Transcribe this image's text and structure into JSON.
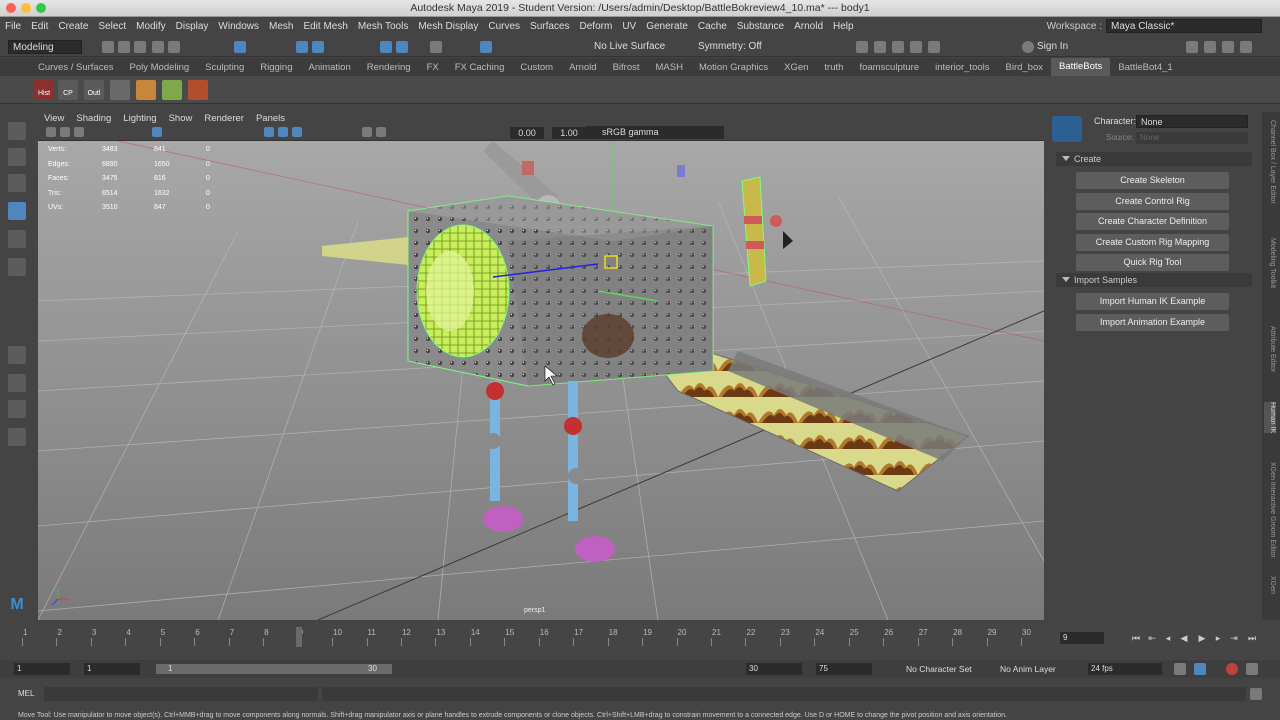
{
  "window": {
    "title": "Autodesk Maya 2019 - Student Version: /Users/admin/Desktop/BattleBokreview4_10.ma* --- body1"
  },
  "menu": [
    "File",
    "Edit",
    "Create",
    "Select",
    "Modify",
    "Display",
    "Windows",
    "Mesh",
    "Edit Mesh",
    "Mesh Tools",
    "Mesh Display",
    "Curves",
    "Surfaces",
    "Deform",
    "UV",
    "Generate",
    "Cache",
    "Substance",
    "Arnold",
    "Help"
  ],
  "workspace": {
    "label": "Workspace :",
    "value": "Maya Classic*"
  },
  "status_line": {
    "mode": "Modeling",
    "live_surface": "No Live Surface",
    "symmetry": "Symmetry: Off",
    "sign_in": "Sign In"
  },
  "shelf_tabs": [
    "Curves / Surfaces",
    "Poly Modeling",
    "Sculpting",
    "Rigging",
    "Animation",
    "Rendering",
    "FX",
    "FX Caching",
    "Custom",
    "Arnold",
    "Bifrost",
    "MASH",
    "Motion Graphics",
    "XGen",
    "truth",
    "foamsculpture",
    "interior_tools",
    "Bird_box",
    "BattleBots",
    "BattleBot4_1"
  ],
  "active_shelf": "BattleBots",
  "shelf_icons": [
    "Hist",
    "CP",
    "Outl"
  ],
  "viewport": {
    "menu": [
      "View",
      "Shading",
      "Lighting",
      "Show",
      "Renderer",
      "Panels"
    ],
    "exposure": "0.00",
    "gamma_value": "1.00",
    "color_space": "sRGB gamma",
    "camera": "persp1",
    "hud": [
      {
        "label": "Verts:",
        "a": "3483",
        "b": "841",
        "c": "0"
      },
      {
        "label": "Edges:",
        "a": "6890",
        "b": "1650",
        "c": "0"
      },
      {
        "label": "Faces:",
        "a": "3475",
        "b": "816",
        "c": "0"
      },
      {
        "label": "Tris:",
        "a": "6514",
        "b": "1632",
        "c": "0"
      },
      {
        "label": "UVs:",
        "a": "3510",
        "b": "847",
        "c": "0"
      }
    ]
  },
  "human_ik": {
    "character_label": "Character:",
    "character_value": "None",
    "source_label": "Source:",
    "source_value": "None",
    "sections": [
      {
        "title": "Create",
        "buttons": [
          "Create Skeleton",
          "Create Control Rig",
          "Create Character Definition",
          "Create Custom Rig Mapping",
          "Quick Rig Tool"
        ]
      },
      {
        "title": "Import Samples",
        "buttons": [
          "Import Human IK Example",
          "Import Animation Example"
        ]
      }
    ]
  },
  "side_tabs": [
    "Channel Box / Layer Editor",
    "Modeling Toolkit",
    "Attribute Editor",
    "Human IK",
    "XGen Interactive Groom Editor",
    "XGen"
  ],
  "timeline": {
    "ticks": [
      "1",
      "2",
      "3",
      "4",
      "5",
      "6",
      "7",
      "8",
      "9",
      "10",
      "11",
      "12",
      "13",
      "14",
      "15",
      "16",
      "17",
      "18",
      "19",
      "20",
      "21",
      "22",
      "23",
      "24",
      "25",
      "26",
      "27",
      "28",
      "29",
      "30"
    ],
    "current_frame": "9",
    "current_frame_field": "9"
  },
  "range": {
    "start": "1",
    "playback_start": "1",
    "slider_start": "1",
    "slider_end": "30",
    "playback_end": "30",
    "end": "75",
    "character_set": "No Character Set",
    "anim_layer": "No Anim Layer",
    "fps": "24 fps"
  },
  "command_line": {
    "label": "MEL"
  },
  "help_line": "Move Tool: Use manipulator to move object(s). Ctrl+MMB+drag to move components along normals. Shift+drag manipulator axis or plane handles to extrude components or clone objects. Ctrl+Shift+LMB+drag to constrain movement to a connected edge. Use D or HOME to change the pivot position and axis orientation.",
  "colors": {
    "accent": "#4f86bd",
    "selection": "#7cff7c",
    "bg": "#444444"
  }
}
